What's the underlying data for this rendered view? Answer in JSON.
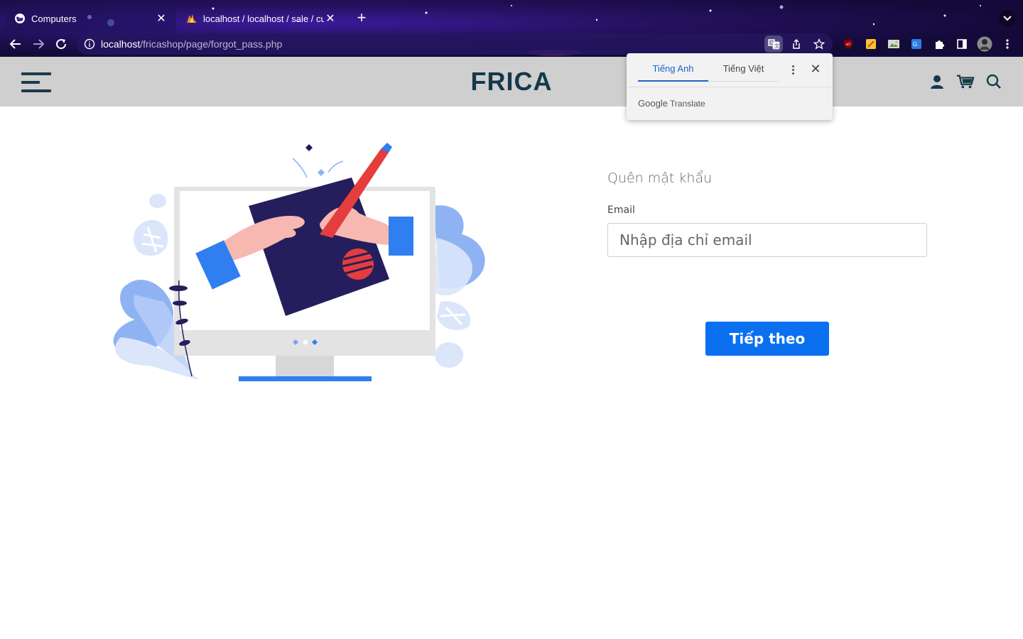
{
  "browser": {
    "tabs": [
      {
        "title": "Computers",
        "favicon": "globe-icon",
        "active": true
      },
      {
        "title": "localhost / localhost / sale / cu",
        "favicon": "phpmyadmin-icon",
        "active": false
      }
    ],
    "url_host": "localhost",
    "url_path": "/fricashop/page/forgot_pass.php"
  },
  "translate_popup": {
    "tab_source": "Tiếng Anh",
    "tab_target": "Tiếng Việt",
    "brand_google": "Google",
    "brand_translate": "Translate"
  },
  "header": {
    "logo": "FRICA",
    "icons": [
      "user-icon",
      "cart-icon",
      "search-icon"
    ]
  },
  "form": {
    "title": "Quên mật khẩu",
    "email_label": "Email",
    "email_placeholder": "Nhập địa chỉ email",
    "email_value": "",
    "submit_label": "Tiếp theo"
  },
  "colors": {
    "header_bg": "#cfcfcf",
    "logo": "#16384a",
    "primary_button": "#0a70f0",
    "translate_accent": "#1a63c7"
  }
}
